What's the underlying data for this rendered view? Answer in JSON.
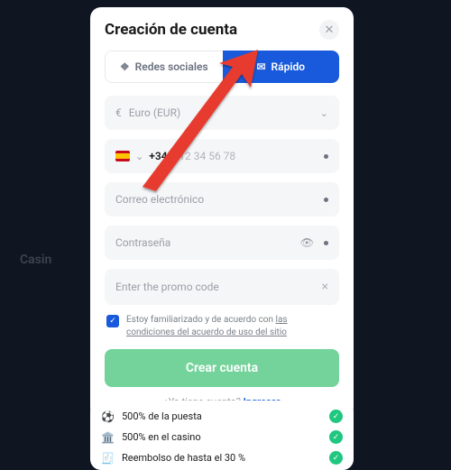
{
  "modal": {
    "title": "Creación de cuenta",
    "tabs": {
      "social": "Redes sociales",
      "quick": "Rápido"
    },
    "currency": {
      "label": "Euro (EUR)",
      "symbol": "€"
    },
    "phone": {
      "prefix": "+34",
      "placeholder": "612 34 56 78"
    },
    "email_placeholder": "Correo electrónico",
    "password_placeholder": "Contraseña",
    "promo_placeholder": "Enter the promo code",
    "consent_pre": "Estoy familiarizado y de acuerdo con ",
    "consent_link": "las condiciones del acuerdo de uso del sitio",
    "submit": "Crear cuenta",
    "login_question": "¿Ya tiene cuenta?",
    "login_action": "Ingresar"
  },
  "bonuses": [
    {
      "icon": "⚽",
      "label": "500% de la puesta"
    },
    {
      "icon": "🏛️",
      "label": "500% en el casino"
    },
    {
      "icon": "🧾",
      "label": "Reembolso de hasta el 30 %"
    }
  ],
  "bg_hint": "Casin"
}
